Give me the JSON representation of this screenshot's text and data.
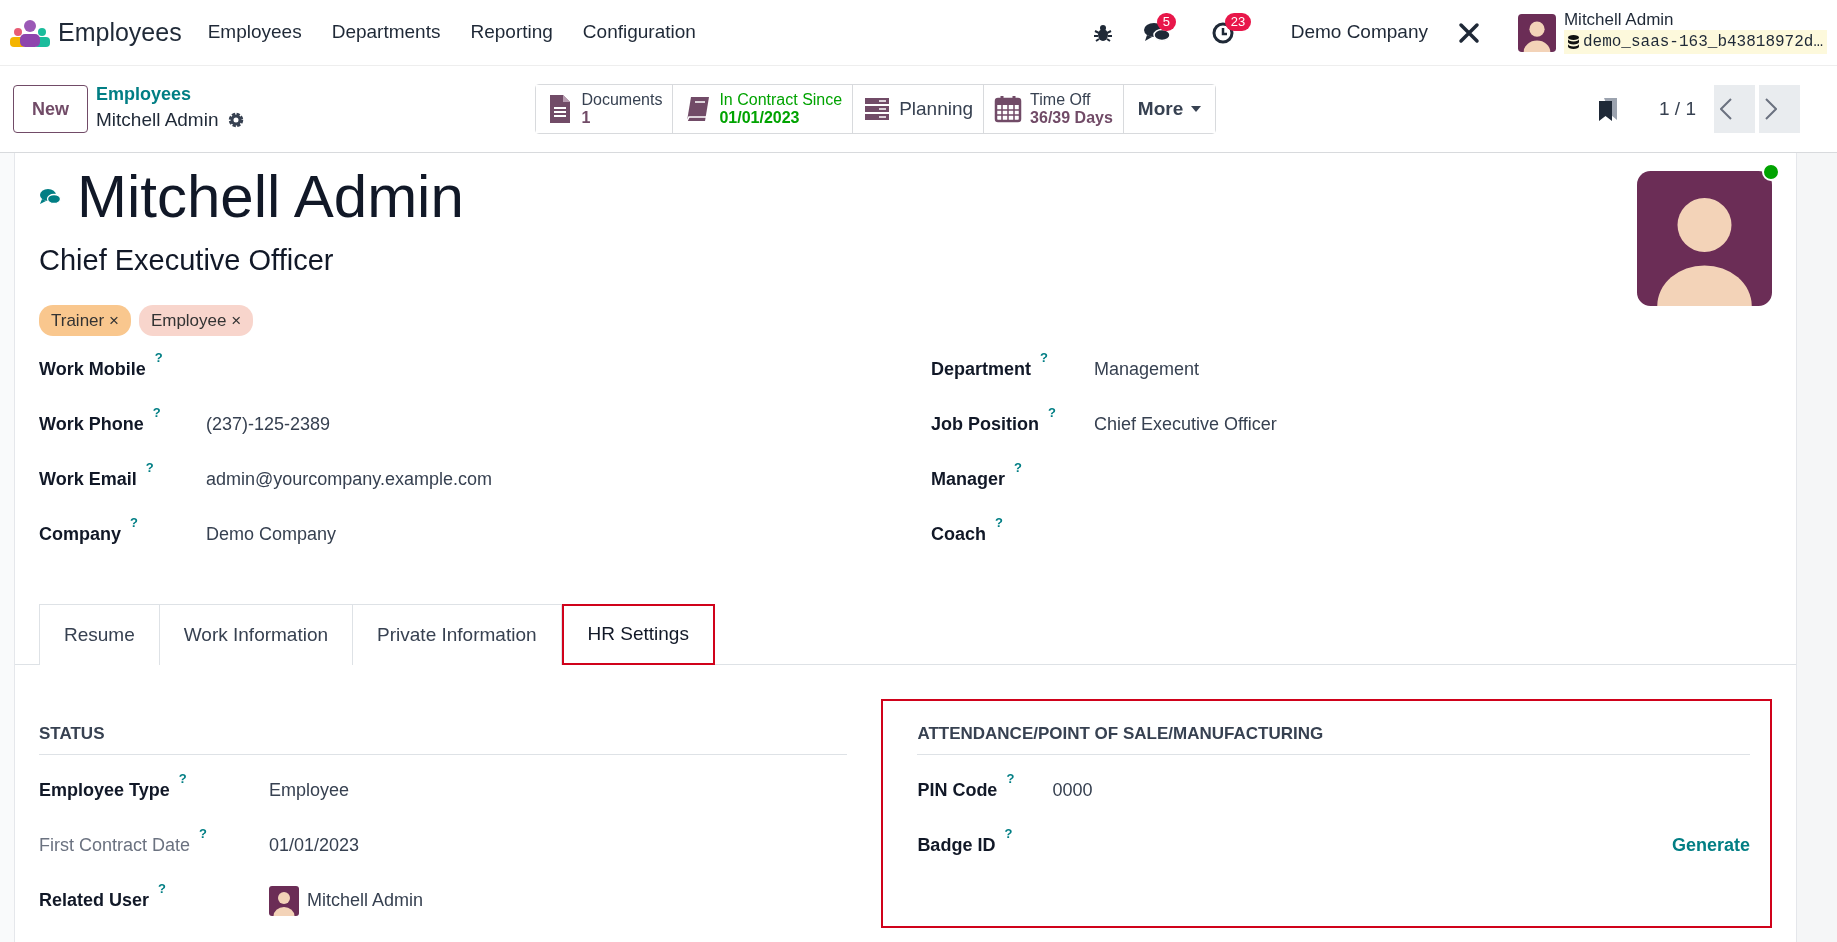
{
  "navbar": {
    "app_name": "Employees",
    "menu": [
      "Employees",
      "Departments",
      "Reporting",
      "Configuration"
    ],
    "messages_count": "5",
    "activities_count": "23",
    "company": "Demo Company",
    "user_name": "Mitchell Admin",
    "database": "demo_saas-163_b43818972d…"
  },
  "control_panel": {
    "new_button": "New",
    "breadcrumb_parent": "Employees",
    "breadcrumb_current": "Mitchell Admin",
    "smart_buttons": [
      {
        "kind": "documents",
        "label": "Documents",
        "value": "1"
      },
      {
        "kind": "contract",
        "label": "In Contract Since",
        "value": "01/01/2023"
      },
      {
        "kind": "planning",
        "label": "Planning"
      },
      {
        "kind": "timeoff",
        "label": "Time Off",
        "value": "36/39 Days"
      }
    ],
    "more_button": "More",
    "pager": "1 / 1"
  },
  "employee": {
    "name": "Mitchell Admin",
    "job_title": "Chief Executive Officer",
    "online": true,
    "tags": [
      {
        "label": "Trainer",
        "remove_mark": "×",
        "color": "#f9c78e"
      },
      {
        "label": "Employee",
        "remove_mark": "×",
        "color": "#f8d5cc"
      }
    ],
    "left_fields": [
      {
        "label": "Work Mobile",
        "tooltip": "?"
      },
      {
        "label": "Work Phone",
        "tooltip": "?",
        "value": "(237)-125-2389"
      },
      {
        "label": "Work Email",
        "tooltip": "?",
        "value": "admin@yourcompany.example.com"
      },
      {
        "label": "Company",
        "tooltip": "?",
        "value": "Demo Company"
      }
    ],
    "right_fields": [
      {
        "label": "Department",
        "tooltip": "?",
        "value": "Management"
      },
      {
        "label": "Job Position",
        "tooltip": "?",
        "value": "Chief Executive Officer"
      },
      {
        "label": "Manager",
        "tooltip": "?"
      },
      {
        "label": "Coach",
        "tooltip": "?"
      }
    ]
  },
  "tabs": [
    {
      "label": "Resume",
      "selected": false,
      "highlighted": false
    },
    {
      "label": "Work Information",
      "selected": false,
      "highlighted": false
    },
    {
      "label": "Private Information",
      "selected": false,
      "highlighted": false
    },
    {
      "label": "HR Settings",
      "selected": true,
      "highlighted": true
    }
  ],
  "sections": [
    {
      "title": "STATUS",
      "highlighted": false,
      "fields": [
        {
          "kind": "text",
          "label": "Employee Type",
          "tooltip": "?",
          "value": "Employee",
          "muted": false
        },
        {
          "kind": "text",
          "label": "First Contract Date",
          "tooltip": "?",
          "value": "01/01/2023",
          "muted": true
        },
        {
          "kind": "user",
          "label": "Related User",
          "tooltip": "?",
          "value": "Mitchell Admin",
          "muted": false
        }
      ]
    },
    {
      "title": "ATTENDANCE/POINT OF SALE/MANUFACTURING",
      "highlighted": true,
      "fields": [
        {
          "kind": "text",
          "label": "PIN Code",
          "tooltip": "?",
          "value": "0000",
          "muted": false
        },
        {
          "kind": "action",
          "label": "Badge ID",
          "tooltip": "?",
          "action": "Generate",
          "muted": false
        }
      ]
    }
  ]
}
